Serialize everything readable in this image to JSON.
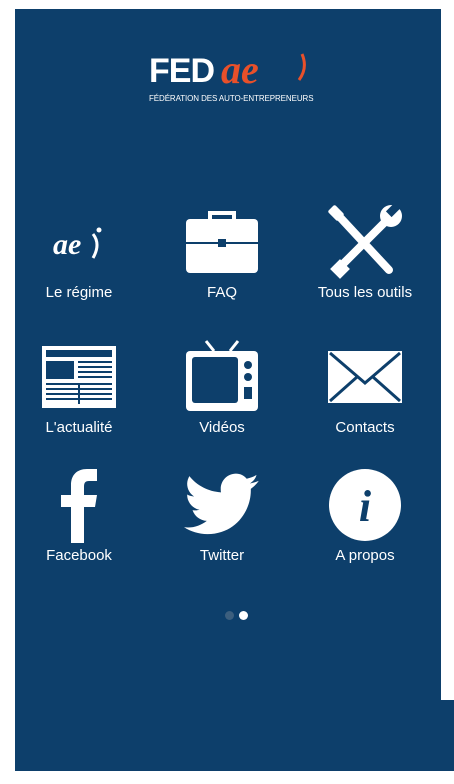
{
  "logo": {
    "brand_main": "FED",
    "brand_accent": "ae",
    "tagline": "FÉDÉRATION DES AUTO-ENTREPRENEURS"
  },
  "menu": [
    {
      "label": "Le régime",
      "icon": "ae-logo-icon"
    },
    {
      "label": "FAQ",
      "icon": "briefcase-icon"
    },
    {
      "label": "Tous les outils",
      "icon": "tools-icon"
    },
    {
      "label": "L'actualité",
      "icon": "newspaper-icon"
    },
    {
      "label": "Vidéos",
      "icon": "tv-icon"
    },
    {
      "label": "Contacts",
      "icon": "envelope-icon"
    },
    {
      "label": "Facebook",
      "icon": "facebook-icon"
    },
    {
      "label": "Twitter",
      "icon": "twitter-icon"
    },
    {
      "label": "A propos",
      "icon": "info-icon"
    }
  ],
  "pager": {
    "pages": 2,
    "current": 2
  },
  "colors": {
    "background": "#0d3f6b",
    "accent": "#e8502a",
    "foreground": "#ffffff"
  }
}
